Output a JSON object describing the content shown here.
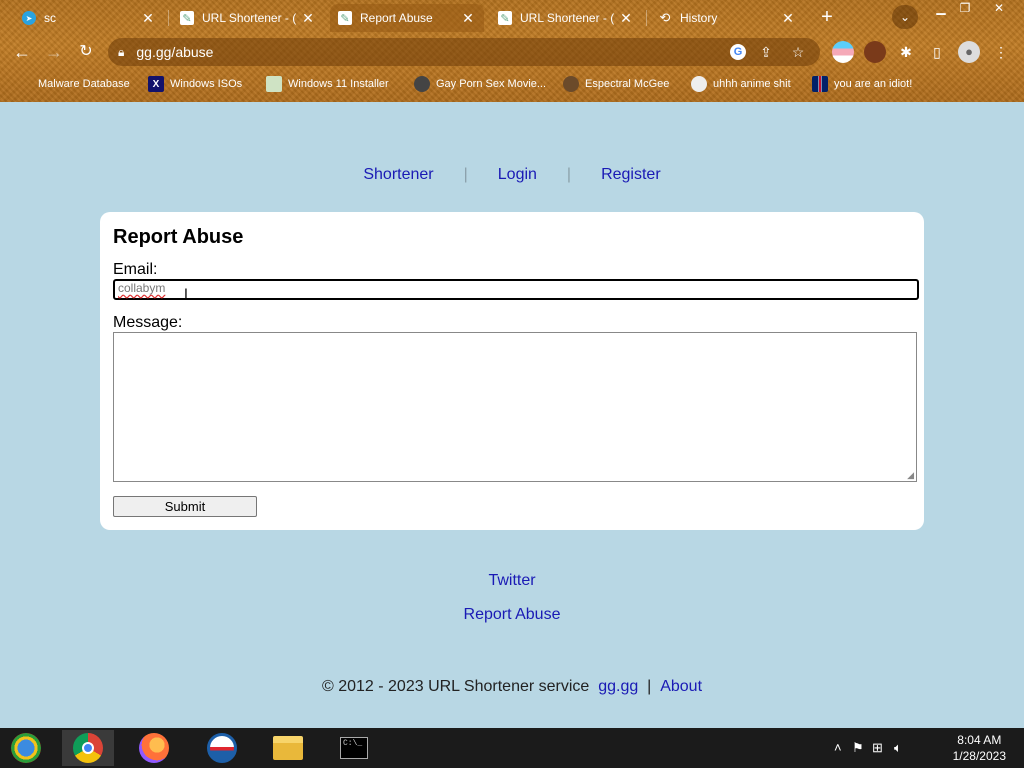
{
  "tabs": [
    {
      "title": "sc",
      "icon": "telegram-icon"
    },
    {
      "title": "URL Shortener - (",
      "icon": "pen-icon"
    },
    {
      "title": "Report Abuse",
      "icon": "pen-icon",
      "active": true
    },
    {
      "title": "URL Shortener - (",
      "icon": "pen-icon"
    },
    {
      "title": "History",
      "icon": "history-icon"
    }
  ],
  "address_bar": {
    "url": "gg.gg/abuse"
  },
  "bookmarks": [
    {
      "label": "Malware Database"
    },
    {
      "label": "Windows ISOs"
    },
    {
      "label": "Windows 11 Installer"
    },
    {
      "label": "Gay Porn Sex Movie..."
    },
    {
      "label": "Espectral McGee"
    },
    {
      "label": "uhhh anime shit"
    },
    {
      "label": "you are an idiot!"
    }
  ],
  "nav": {
    "shortener": "Shortener",
    "login": "Login",
    "register": "Register",
    "separator": "|"
  },
  "form": {
    "title": "Report Abuse",
    "email_label": "Email:",
    "email_value": "collabym",
    "message_label": "Message:",
    "submit_label": "Submit"
  },
  "footer": {
    "twitter": "Twitter",
    "report_abuse": "Report Abuse",
    "copyright": "© 2012 - 2023 URL Shortener service",
    "site_link": "gg.gg",
    "separator": "|",
    "about": "About"
  },
  "system_tray": {
    "time": "8:04 AM",
    "date": "1/28/2023"
  },
  "colors": {
    "link": "#1a1ab5",
    "page_bg": "#b8d7e4",
    "chrome_bg": "#b5731f"
  }
}
